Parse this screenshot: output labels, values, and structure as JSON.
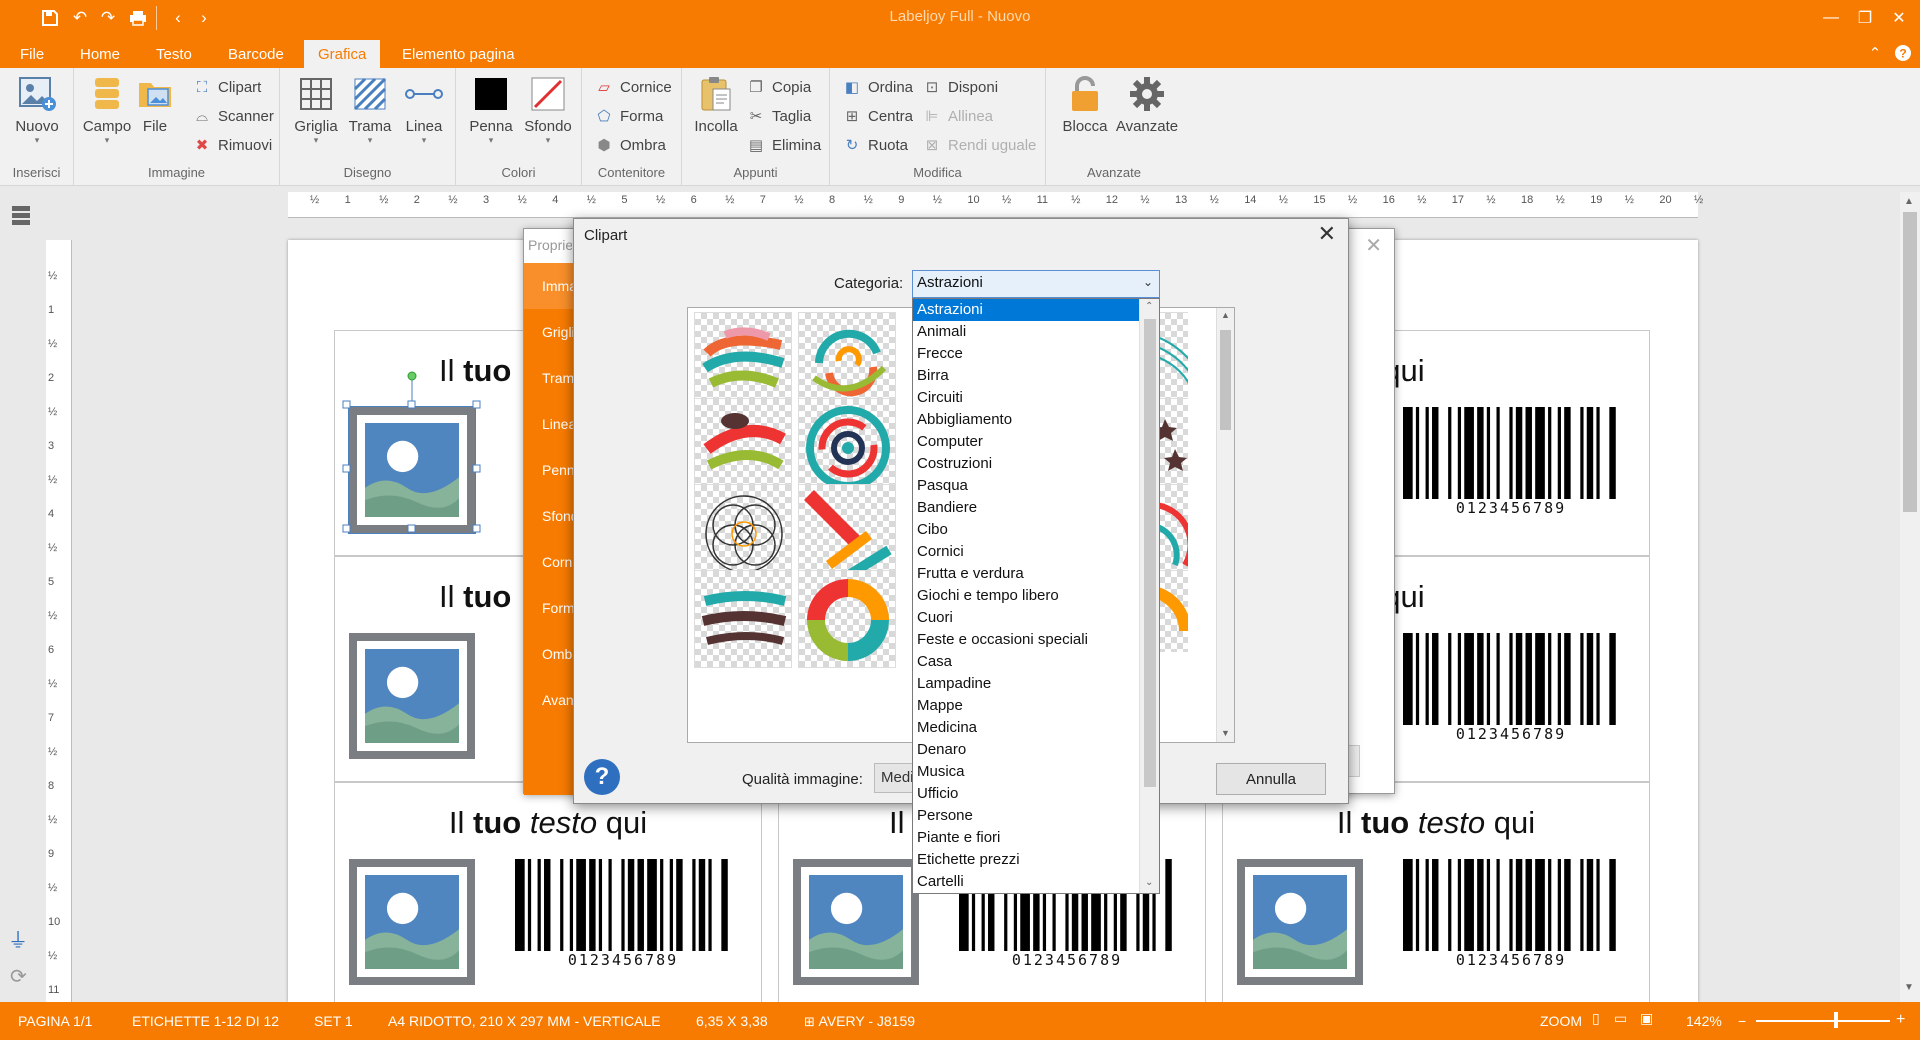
{
  "app": {
    "title": "Labeljoy Full - Nuovo"
  },
  "menu": {
    "tabs": [
      "File",
      "Home",
      "Testo",
      "Barcode",
      "Grafica",
      "Elemento pagina"
    ],
    "active": "Grafica"
  },
  "ribbon": {
    "inserisci": {
      "label": "Inserisci",
      "nuovo": "Nuovo"
    },
    "immagine": {
      "label": "Immagine",
      "campo": "Campo",
      "file": "File",
      "clipart": "Clipart",
      "scanner": "Scanner",
      "rimuovi": "Rimuovi"
    },
    "disegno": {
      "label": "Disegno",
      "griglia": "Griglia",
      "trama": "Trama",
      "linea": "Linea"
    },
    "colori": {
      "label": "Colori",
      "penna": "Penna",
      "sfondo": "Sfondo"
    },
    "contenitore": {
      "label": "Contenitore",
      "cornice": "Cornice",
      "forma": "Forma",
      "ombra": "Ombra"
    },
    "appunti": {
      "label": "Appunti",
      "incolla": "Incolla",
      "copia": "Copia",
      "taglia": "Taglia",
      "elimina": "Elimina"
    },
    "modifica": {
      "label": "Modifica",
      "ordina": "Ordina",
      "centra": "Centra",
      "ruota": "Ruota",
      "disponi": "Disponi",
      "allinea": "Allinea",
      "rendi_uguale": "Rendi uguale"
    },
    "avanzate": {
      "label": "Avanzate",
      "blocca": "Blocca",
      "avanzate_btn": "Avanzate"
    }
  },
  "ruler": {
    "h_ticks": [
      "½",
      "1",
      "½",
      "2",
      "½",
      "3",
      "½",
      "4",
      "½",
      "5",
      "½",
      "6",
      "½",
      "7",
      "½",
      "8",
      "½",
      "9",
      "½",
      "10",
      "½",
      "11",
      "½",
      "12",
      "½",
      "13",
      "½",
      "14",
      "½",
      "15",
      "½",
      "16",
      "½",
      "17",
      "½",
      "18",
      "½",
      "19",
      "½",
      "20",
      "½"
    ],
    "v_ticks": [
      "½",
      "1",
      "½",
      "2",
      "½",
      "3",
      "½",
      "4",
      "½",
      "5",
      "½",
      "6",
      "½",
      "7",
      "½",
      "8",
      "½",
      "9",
      "½",
      "10",
      "½",
      "11"
    ]
  },
  "label": {
    "text_pre": "Il ",
    "text_bold": "tuo",
    "text_italic": "testo",
    "text_post": " qui",
    "barcode_number": "0123456789",
    "partial_left": "Il tuo",
    "partial_right_italic": "testo",
    "partial_right_post": " qui",
    "partial_mid": "Il"
  },
  "props_dialog": {
    "title": "Proprietà",
    "items": [
      "Immagine",
      "Griglia",
      "Trama",
      "Linea",
      "Penna",
      "Sfondo",
      "Cornice",
      "Forma",
      "Ombra",
      "Avanzate"
    ]
  },
  "clipart_dialog": {
    "title": "Clipart",
    "category_label": "Categoria:",
    "category_value": "Astrazioni",
    "quality_label": "Qualità immagine:",
    "quality_value": "Media",
    "cancel": "Annulla",
    "categories": [
      "Astrazioni",
      "Animali",
      "Frecce",
      "Birra",
      "Circuiti",
      "Abbigliamento",
      "Computer",
      "Costruzioni",
      "Pasqua",
      "Bandiere",
      "Cibo",
      "Cornici",
      "Frutta e verdura",
      "Giochi e tempo libero",
      "Cuori",
      "Feste e occasioni speciali",
      "Casa",
      "Lampadine",
      "Mappe",
      "Medicina",
      "Denaro",
      "Musica",
      "Ufficio",
      "Persone",
      "Piante e fiori",
      "Etichette prezzi",
      "Cartelli"
    ]
  },
  "status": {
    "pagina": "PAGINA 1/1",
    "etichette": "ETICHETTE 1-12 DI 12",
    "set": "SET 1",
    "formato": "A4 RIDOTTO, 210 X 297 MM - VERTICALE",
    "dim": "6,35 X 3,38",
    "avery": "AVERY - J8159",
    "zoom_label": "ZOOM",
    "zoom_value": "142%"
  },
  "colors": {
    "accent": "#f77b00",
    "selection": "#0078d7"
  }
}
